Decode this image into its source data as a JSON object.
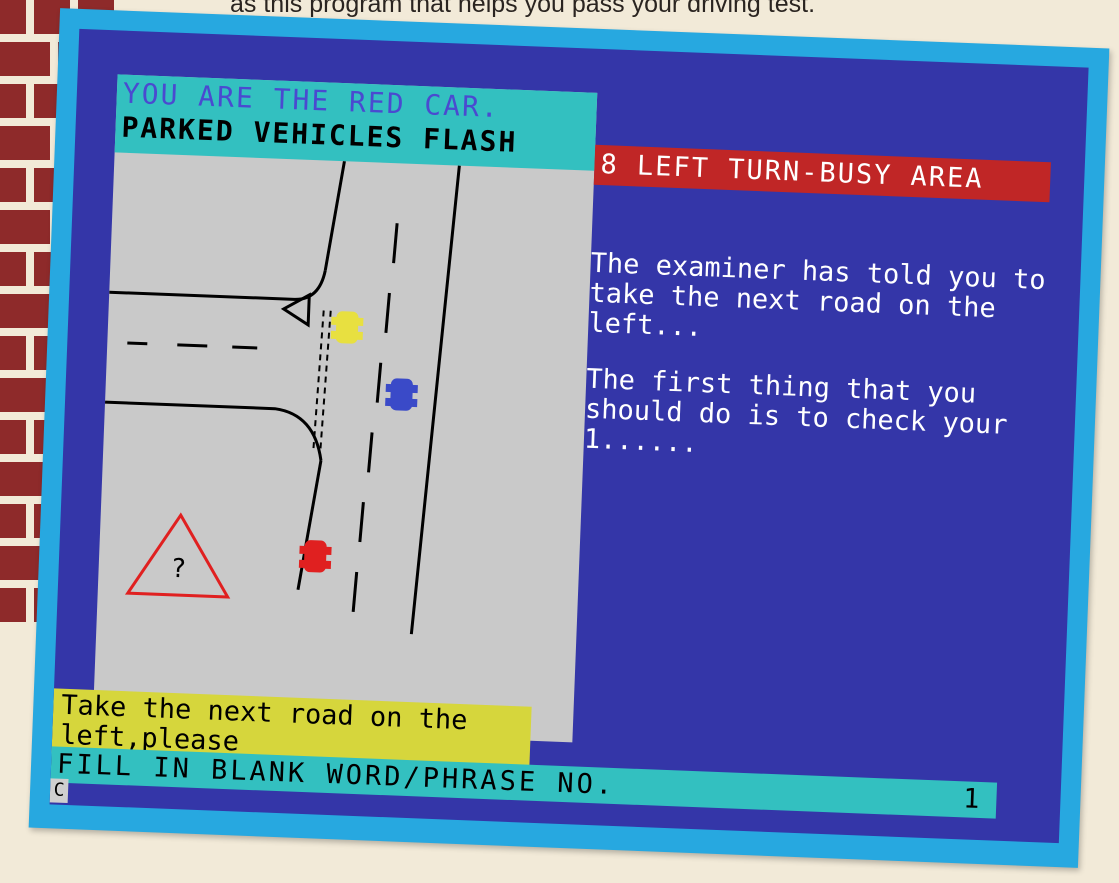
{
  "caption": "as this program that helps you pass your driving test.",
  "screen": {
    "info_line1": "YOU ARE THE RED CAR.",
    "info_line2": "PARKED VEHICLES FLASH",
    "lesson_title": "8 LEFT TURN-BUSY AREA",
    "paragraph1": "The examiner has told you to take the next road on the left...",
    "paragraph2": "The first thing that you should do is to check your 1......",
    "instruction": "Take the next road on the left,please",
    "fill_prompt": "FILL IN BLANK WORD/PHRASE NO.",
    "fill_number": "1",
    "cursor": "C",
    "sign_glyph": "?"
  },
  "colors": {
    "page_bg": "#f2ead8",
    "frame": "#27a8e0",
    "screen_bg": "#3436a8",
    "road": "#c9c9c9",
    "cyan_bar": "#33c0c0",
    "red_bar": "#c02626",
    "yellow_bar": "#d6d63c",
    "player_car": "#e02020",
    "yellow_car": "#e8e040",
    "blue_car": "#3a4ac8"
  }
}
